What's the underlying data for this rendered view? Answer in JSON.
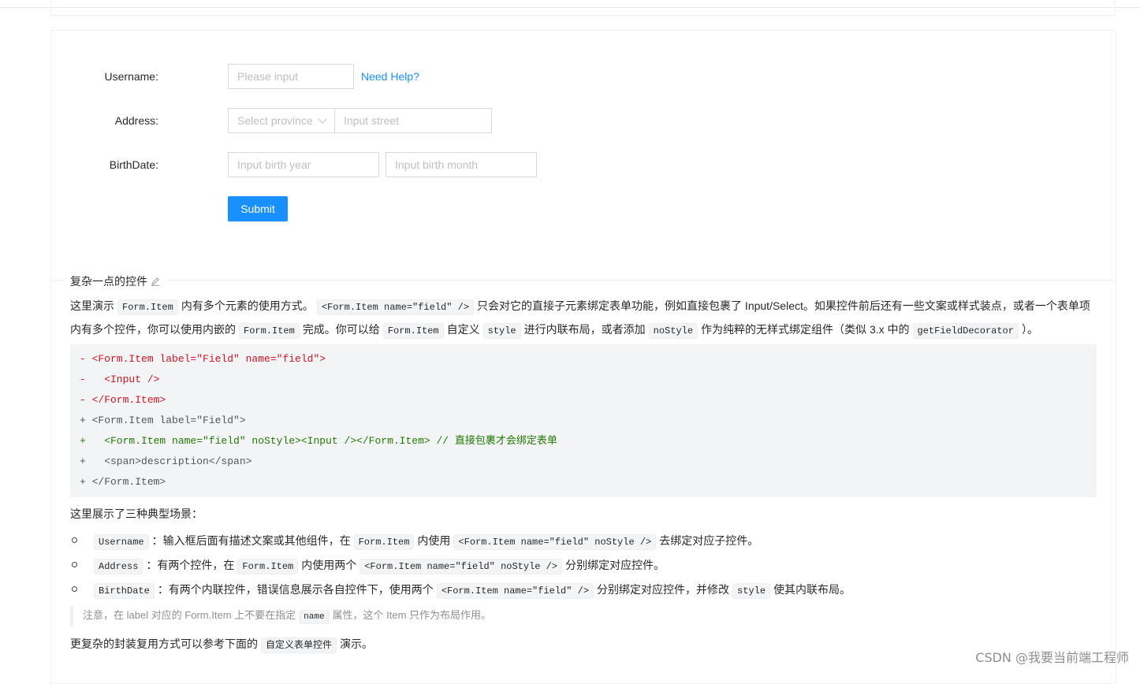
{
  "form": {
    "username_label": "Username",
    "username_placeholder": "Please input",
    "need_help": "Need Help?",
    "address_label": "Address",
    "province_placeholder": "Select province",
    "street_placeholder": "Input street",
    "birthdate_label": "BirthDate",
    "birth_year_placeholder": "Input birth year",
    "birth_month_placeholder": "Input birth month",
    "submit": "Submit"
  },
  "meta": {
    "title": "复杂一点的控件",
    "p1_a": "这里演示",
    "p1_code1": "Form.Item",
    "p1_b": "内有多个元素的使用方式。",
    "p1_code2": "<Form.Item name=\"field\" />",
    "p1_c": "只会对它的直接子元素绑定表单功能，例如直接包裹了 Input/Select。如果控件前后还有一些文案或样式装点，或者一个表单项内有多个控件，你可以使用内嵌的",
    "p1_code3": "Form.Item",
    "p1_d": "完成。你可以给",
    "p1_code4": "Form.Item",
    "p1_e": "自定义",
    "p1_code5": "style",
    "p1_f": "进行内联布局，或者添加",
    "p1_code6": "noStyle",
    "p1_g": "作为纯粹的无样式绑定组件（类似 3.x 中的",
    "p1_code7": "getFieldDecorator",
    "p1_h": "）。"
  },
  "code_lines": [
    {
      "kind": "del",
      "text": "- <Form.Item label=\"Field\" name=\"field\">"
    },
    {
      "kind": "del",
      "text": "-   <Input />"
    },
    {
      "kind": "del",
      "text": "- </Form.Item>"
    },
    {
      "kind": "neu",
      "text": "+ <Form.Item label=\"Field\">"
    },
    {
      "kind": "ins",
      "text": "+   <Form.Item name=\"field\" noStyle><Input /></Form.Item> // 直接包裹才会绑定表单"
    },
    {
      "kind": "neu",
      "text": "+   <span>description</span>"
    },
    {
      "kind": "neu",
      "text": "+ </Form.Item>"
    }
  ],
  "scenes_intro": "这里展示了三种典型场景：",
  "scenes": [
    {
      "code1": "Username",
      "t1": "：输入框后面有描述文案或其他组件，在",
      "code2": "Form.Item",
      "t2": "内使用",
      "code3": "<Form.Item name=\"field\" noStyle />",
      "t3": "去绑定对应子控件。"
    },
    {
      "code1": "Address",
      "t1": "：有两个控件，在",
      "code2": "Form.Item",
      "t2": "内使用两个",
      "code3": "<Form.Item name=\"field\" noStyle />",
      "t3": "分别绑定对应控件。"
    },
    {
      "code1": "BirthDate",
      "t1": "：有两个内联控件，错误信息展示各自控件下，使用两个",
      "code2": "<Form.Item name=\"field\" />",
      "t2": "分别绑定对应控件，并修改",
      "code3": "style",
      "t3": "使其内联布局。"
    }
  ],
  "note": {
    "a": "注意，在 label 对应的 Form.Item 上不要在指定",
    "code": "name",
    "b": "属性，这个 Item 只作为布局作用。"
  },
  "footer": {
    "a": "更复杂的封装复用方式可以参考下面的",
    "code": "自定义表单控件",
    "b": "演示。"
  },
  "watermark": "CSDN @我要当前端工程师",
  "colors": {
    "primary": "#1890ff",
    "deleted": "#cf1322",
    "inserted": "#237804"
  }
}
